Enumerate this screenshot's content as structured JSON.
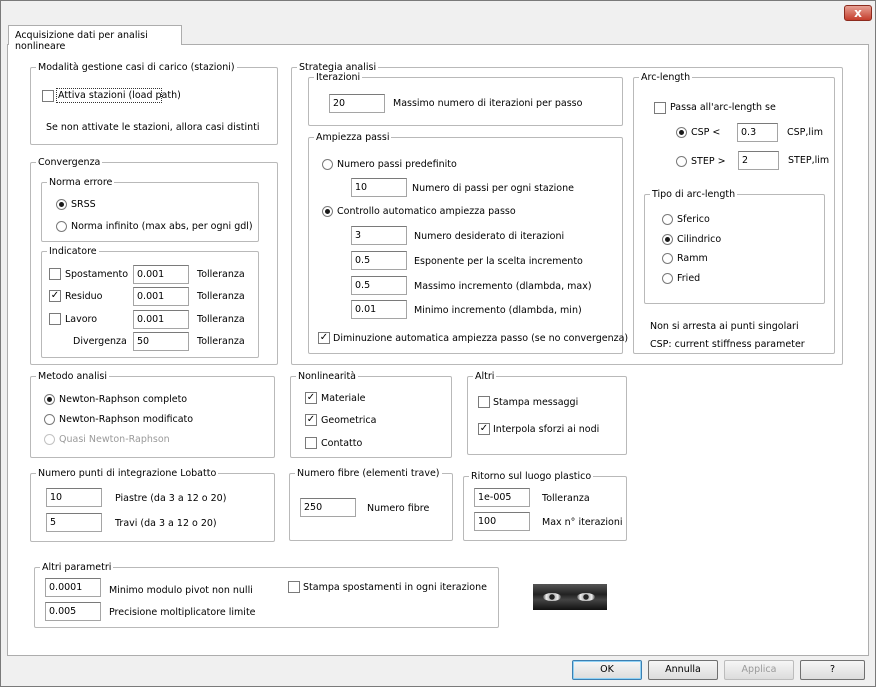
{
  "window": {
    "close_label": "x"
  },
  "tab": {
    "label": "Acquisizione dati per analisi nonlineare"
  },
  "stations": {
    "legend": "Modalità gestione casi di carico (stazioni)",
    "attiva_label": "Attiva stazioni (load path)",
    "note": "Se non attivate le stazioni, allora casi distinti"
  },
  "convergenza": {
    "legend": "Convergenza",
    "norma": {
      "legend": "Norma errore",
      "srss": "SRSS",
      "infinito": "Norma infinito (max abs, per ogni gdl)"
    },
    "indicatore": {
      "legend": "Indicatore",
      "spostamento": {
        "label": "Spostamento",
        "value": "0.001",
        "toll": "Tolleranza"
      },
      "residuo": {
        "label": "Residuo",
        "value": "0.001",
        "toll": "Tolleranza"
      },
      "lavoro": {
        "label": "Lavoro",
        "value": "0.001",
        "toll": "Tolleranza"
      },
      "divergenza": {
        "label": "Divergenza",
        "value": "50",
        "toll": "Tolleranza"
      }
    }
  },
  "strategia": {
    "legend": "Strategia analisi",
    "iterazioni": {
      "legend": "Iterazioni",
      "value": "20",
      "label": "Massimo numero di iterazioni per passo"
    },
    "ampiezza": {
      "legend": "Ampiezza passi",
      "predefinito": "Numero passi predefinito",
      "passi_value": "10",
      "passi_label": "Numero di passi per ogni stazione",
      "automatico": "Controllo automatico ampiezza passo",
      "iter_value": "3",
      "iter_label": "Numero desiderato di iterazioni",
      "esp_value": "0.5",
      "esp_label": "Esponente per la scelta incremento",
      "max_value": "0.5",
      "max_label": "Massimo incremento (dlambda, max)",
      "min_value": "0.01",
      "min_label": "Minimo incremento (dlambda, min)",
      "diminuzione": "Diminuzione automatica ampiezza passo (se no convergenza)"
    },
    "arc": {
      "legend": "Arc-length",
      "passa": "Passa all'arc-length se",
      "csp": "CSP <",
      "csp_value": "0.3",
      "csp_lim": "CSP,lim",
      "step": "STEP >",
      "step_value": "2",
      "step_lim": "STEP,lim",
      "tipo": {
        "legend": "Tipo di arc-length",
        "sferico": "Sferico",
        "cilindrico": "Cilindrico",
        "ramm": "Ramm",
        "fried": "Fried"
      },
      "note1": "Non si arresta ai punti singolari",
      "note2": "CSP: current stiffness parameter"
    }
  },
  "metodo": {
    "legend": "Metodo analisi",
    "completo": "Newton-Raphson completo",
    "modificato": "Newton-Raphson modificato",
    "quasi": "Quasi Newton-Raphson"
  },
  "nonlinearita": {
    "legend": "Nonlinearità",
    "materiale": "Materiale",
    "geometrica": "Geometrica",
    "contatto": "Contatto"
  },
  "altri": {
    "legend": "Altri",
    "stampa": "Stampa messaggi",
    "interpola": "Interpola sforzi ai nodi"
  },
  "lobatto": {
    "legend": "Numero punti di integrazione Lobatto",
    "piastre_value": "10",
    "piastre_label": "Piastre (da 3 a 12 o 20)",
    "travi_value": "5",
    "travi_label": "Travi (da 3 a 12 o 20)"
  },
  "fibre": {
    "legend": "Numero fibre (elementi trave)",
    "value": "250",
    "label": "Numero fibre"
  },
  "ritorno": {
    "legend": "Ritorno sul luogo plastico",
    "toll_value": "1e-005",
    "toll_label": "Tolleranza",
    "iter_value": "100",
    "iter_label": "Max n° iterazioni"
  },
  "altri_param": {
    "legend": "Altri parametri",
    "pivot_value": "0.0001",
    "pivot_label": "Minimo modulo pivot non nulli",
    "prec_value": "0.005",
    "prec_label": "Precisione moltiplicatore limite",
    "stampa": "Stampa spostamenti in ogni iterazione"
  },
  "buttons": {
    "ok": "OK",
    "annulla": "Annulla",
    "applica": "Applica",
    "help": "?"
  }
}
